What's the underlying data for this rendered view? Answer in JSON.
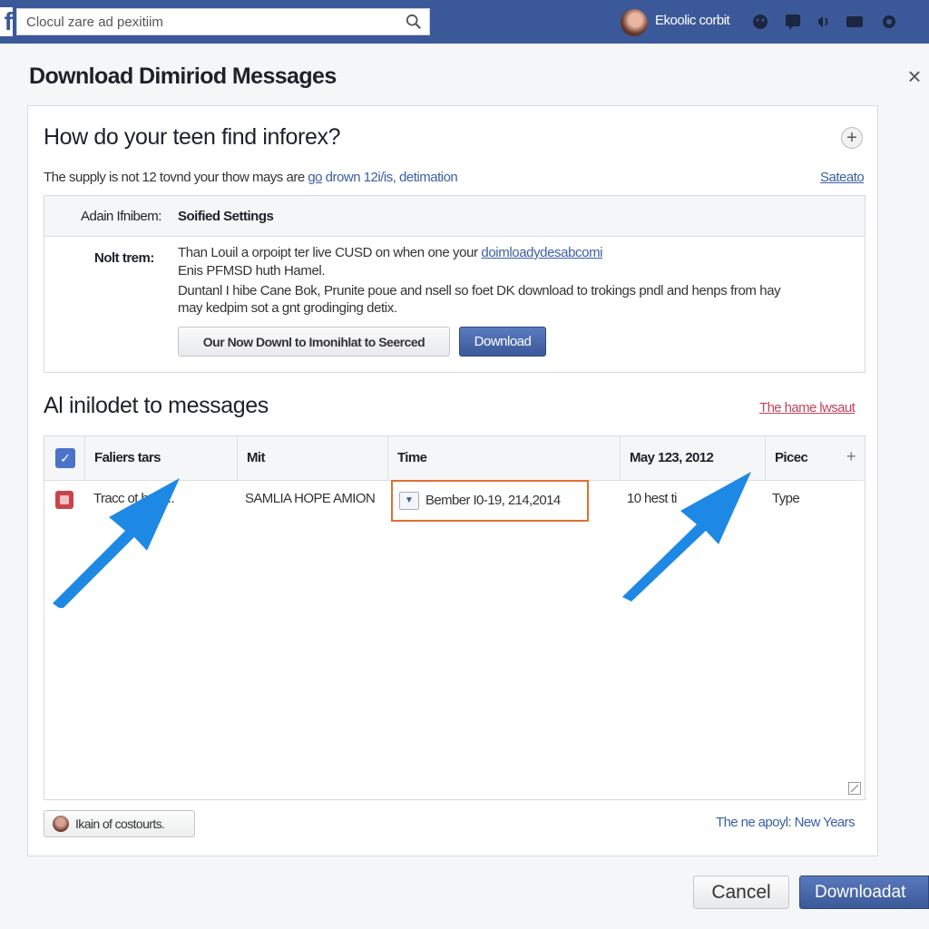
{
  "topbar": {
    "logo": "f",
    "search_value": "Clocul zare ad pexitiim",
    "user_name": "Ekoolic corbit"
  },
  "dialog": {
    "title": "Download Dimiriod Messages",
    "close": "×"
  },
  "question": {
    "title": "How do your teen find inforex?",
    "plus": "+",
    "desc_text": "The supply is not 12 tovnd your thow mays are ",
    "desc_link1": "go",
    "desc_link2": " drown 12i/is, detimation",
    "side_link": "Sateato"
  },
  "settings": {
    "label": "Adain Ifnibem:",
    "value": "Soified Settings",
    "note_label": "Nolt trem:",
    "line1_text": "Than Louil a orpoipt ter live CUSD on when one your ",
    "line1_link": "doimloadydesabcomi",
    "line2": "Enis PFMSD huth Hamel.",
    "line3": "Duntanl I hibe Cane Bok, Prunite poue and nsell so foet DK download to trokings pndl and henps from hay",
    "line4": "may kedpim sot a gnt grodinging detix.",
    "btn_gray": "Our Now Downl to Imonihlat to Seerced",
    "btn_blue": "Download"
  },
  "messages": {
    "title": "Al inilodet to messages",
    "link": "The hame lwsaut",
    "columns": [
      "Faliers tars",
      "Mit",
      "Time",
      "May 123, 2012",
      "Picec"
    ],
    "header_check": "✓",
    "header_plus": "+",
    "row": {
      "col1": "Tracc        ot helo...",
      "col2": "SAMLIA HOPE AMION",
      "time": "Bember I0-19, 214,2014",
      "col4": "10 hest ti",
      "col5": "Type"
    }
  },
  "footer": {
    "contacts": "Ikain of costourts.",
    "link": "The ne apoyl: New Years",
    "cancel": "Cancel",
    "download": "Downloadat"
  },
  "colors": {
    "brand": "#3b5998",
    "arrow": "#1e88e5",
    "highlight": "#e07033",
    "link": "#3a5fa8"
  }
}
